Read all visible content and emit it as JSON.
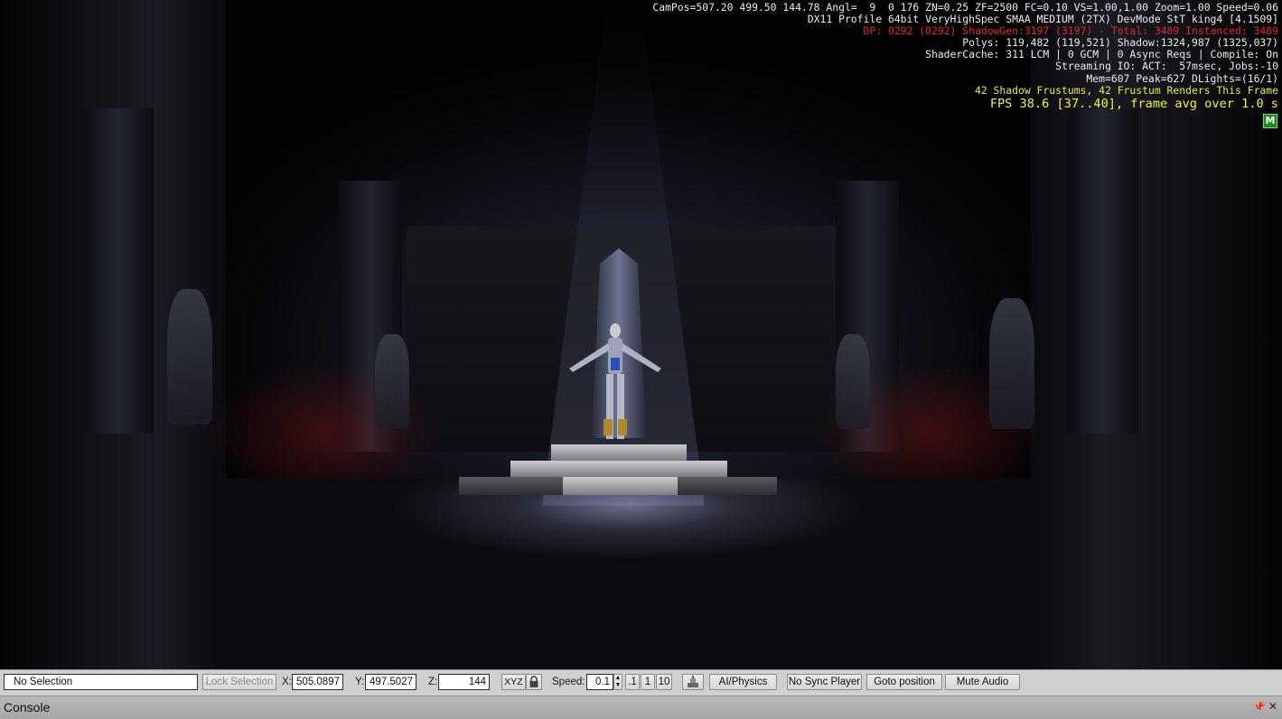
{
  "stats": {
    "line1": "CamPos=507.20 499.50 144.78 Angl=  9  0 176 ZN=0.25 ZF=2500 FC=0.10 VS=1.00,1.00 Zoom=1.00 Speed=0.06",
    "line2": "DX11 Profile 64bit VeryHighSpec SMAA MEDIUM (2TX) DevMode StT king4 [4.1509]",
    "line3": "DP: 0292 (0292) ShadowGen:3197 (3197) - Total: 3489 Instanced: 3489",
    "line4": "Polys: 119,482 (119,521) Shadow:1324,987 (1325,037)",
    "line5": "ShaderCache: 311 LCM | 0 GCM | 0 Async Reqs | Compile: On",
    "line6": "Streaming IO: ACT:  57msec, Jobs:-10",
    "line7": "Mem=607 Peak=627 DLights=(16/1)",
    "line8": "42 Shadow Frustums, 42 Frustum Renders This Frame",
    "fps": "FPS 38.6 [37..40], frame avg over 1.0 s",
    "badge": "M"
  },
  "toolbar": {
    "selection": "No Selection",
    "lock_selection": "Lock Selection",
    "x_label": "X:",
    "x_value": "505.0897",
    "y_label": "Y:",
    "y_value": "497.5027",
    "z_label": "Z:",
    "z_value": "144",
    "xyz": "XYZ",
    "speed_label": "Speed:",
    "speed_value": "0.1",
    "speed_presets": [
      ".1",
      "1",
      "10"
    ],
    "ai_physics": "AI/Physics",
    "no_sync_player": "No Sync Player",
    "goto_position": "Goto position",
    "mute_audio": "Mute Audio"
  },
  "console": {
    "title": "Console"
  },
  "colors": {
    "stat_text": "#ececec",
    "stat_red": "#e0262b",
    "stat_yellow": "#e8e84a",
    "badge_green": "#1a8c1a",
    "toolbar_bg": "#cfcfcf"
  }
}
